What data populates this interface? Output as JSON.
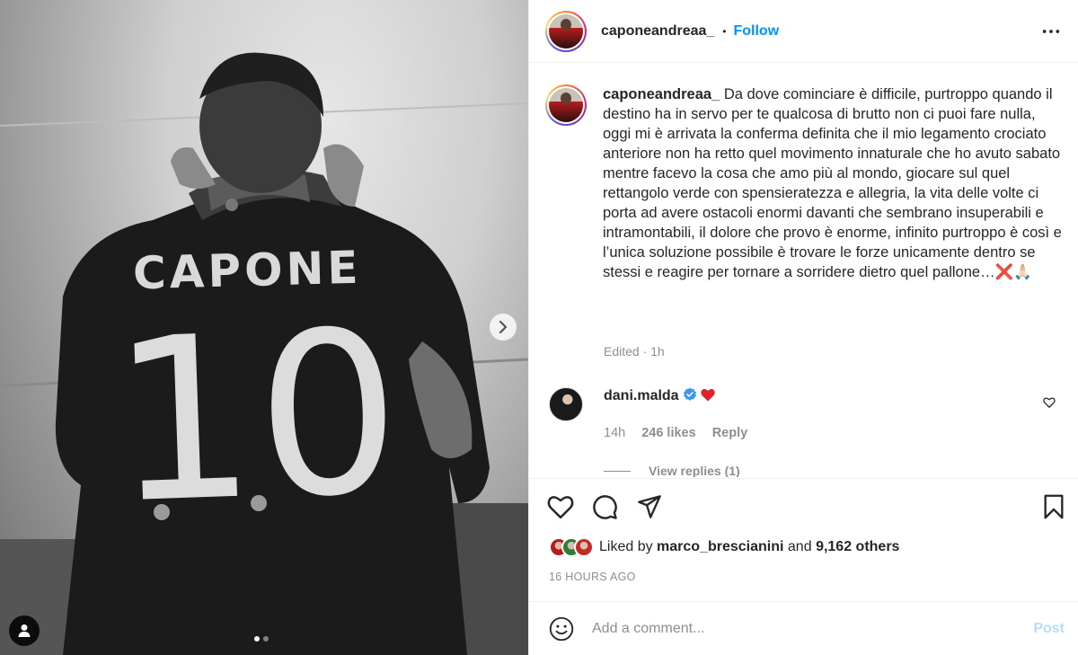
{
  "post": {
    "username": "caponeandreaa_",
    "separator": "•",
    "follow_label": "Follow",
    "more_icon": "more-horizontal-icon",
    "photo": {
      "jersey_name": "CAPONE",
      "jersey_number": "10",
      "carousel_dots": 2,
      "active_dot": 0,
      "next_icon": "chevron-right-icon",
      "tag_icon": "user-tag-icon"
    },
    "caption": {
      "username": "caponeandreaa_",
      "text": "Da dove cominciare è difficile, purtroppo quando il destino ha in servo per te qualcosa di brutto non ci puoi fare nulla, oggi mi è arrivata la conferma definita che il mio legamento crociato anteriore non ha retto quel movimento innaturale che ho avuto sabato mentre facevo la cosa che amo più al mondo, giocare sul quel rettangolo verde con spensieratezza e allegria, la vita delle volte ci porta ad avere ostacoli enormi davanti che sembrano insuperabili e intramontabili, il dolore che provo è enorme, infinito purtroppo è così e l’unica soluzione possibile è trovare le forze unicamente dentro se stessi e reagire per tornare a sorridere dietro quel pallone…❌🙏🏻",
      "edited": "Edited · 1h"
    },
    "comments": [
      {
        "username": "dani.malda",
        "verified": true,
        "text": "❤️",
        "time": "14h",
        "likes": "246 likes",
        "reply_label": "Reply",
        "view_replies": "View replies (1)"
      }
    ],
    "actions": {
      "like_icon": "heart-icon",
      "comment_icon": "comment-icon",
      "share_icon": "paper-plane-icon",
      "save_icon": "bookmark-icon"
    },
    "likes": {
      "prefix": "Liked by",
      "user": "marco_brescianini",
      "conjunction": "and",
      "others": "9,162 others"
    },
    "timestamp": "16 HOURS AGO",
    "add_comment": {
      "placeholder": "Add a comment...",
      "post_label": "Post",
      "emoji_icon": "smiley-icon"
    }
  },
  "colors": {
    "accent": "#0095f6",
    "post_disabled": "#b2dffc",
    "muted_text": "#8e8e8e",
    "text": "#262626",
    "heart": "#ed4956"
  }
}
